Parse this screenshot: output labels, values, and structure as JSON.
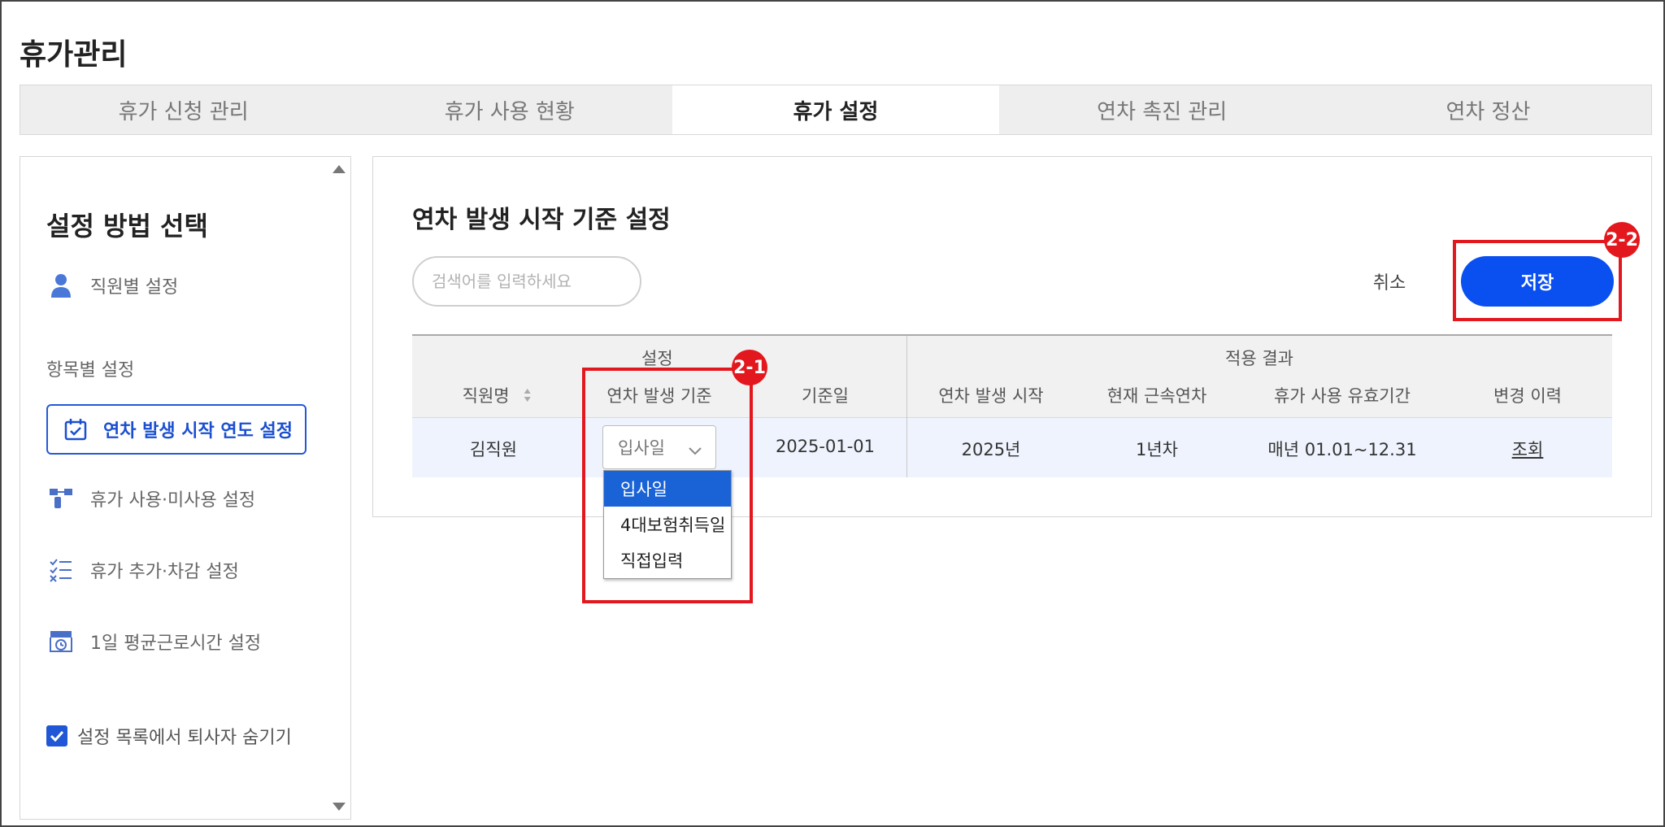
{
  "page_title": "휴가관리",
  "tabs": [
    {
      "label": "휴가 신청 관리",
      "active": false
    },
    {
      "label": "휴가 사용 현황",
      "active": false
    },
    {
      "label": "휴가 설정",
      "active": true
    },
    {
      "label": "연차 촉진 관리",
      "active": false
    },
    {
      "label": "연차 정산",
      "active": false
    }
  ],
  "sidebar": {
    "heading": "설정 방법 선택",
    "employee_setting": "직원별 설정",
    "section_label": "항목별 설정",
    "items": [
      {
        "label": "연차 발생 시작 연도 설정",
        "icon": "calendar-check-icon",
        "active": true
      },
      {
        "label": "휴가 사용·미사용 설정",
        "icon": "toggle-blocks-icon",
        "active": false
      },
      {
        "label": "휴가 추가·차감 설정",
        "icon": "checklist-icon",
        "active": false
      },
      {
        "label": "1일 평균근로시간 설정",
        "icon": "clock-board-icon",
        "active": false
      }
    ],
    "hide_resigned_label": "설정 목록에서 퇴사자 숨기기",
    "hide_resigned_checked": true
  },
  "main": {
    "title": "연차 발생 시작 기준 설정",
    "search_placeholder": "검색어를 입력하세요",
    "search_value": "",
    "cancel_label": "취소",
    "save_label": "저장",
    "annotations": {
      "dropdown_badge": "2-1",
      "save_badge": "2-2"
    }
  },
  "table": {
    "group_settings": "설정",
    "group_result": "적용 결과",
    "headers": [
      "직원명",
      "연차 발생 기준",
      "기준일",
      "연차 발생 시작",
      "현재 근속연차",
      "휴가 사용 유효기간",
      "변경 이력"
    ],
    "row": {
      "name": "김직원",
      "basis_selected": "입사일",
      "base_date": "2025-01-01",
      "start_year": "2025년",
      "service_year": "1년차",
      "valid_period": "매년 01.01~12.31",
      "history_link": "조회"
    }
  },
  "dropdown": {
    "options": [
      "입사일",
      "4대보험취득일",
      "직접입력"
    ],
    "selected_index": 0
  },
  "colors": {
    "accent": "#0a4ff0",
    "annotation_red": "#e3181e",
    "selected_option": "#1a63d6"
  }
}
